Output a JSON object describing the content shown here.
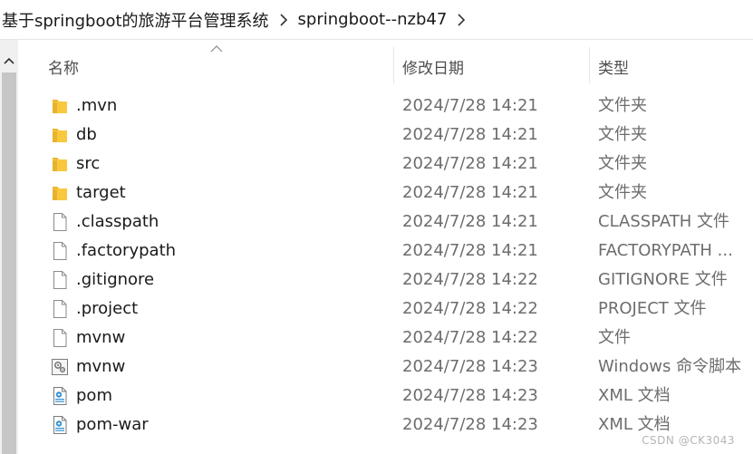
{
  "breadcrumb": {
    "items": [
      "基于springboot的旅游平台管理系统",
      "springboot--nzb47"
    ]
  },
  "columns": {
    "name": "名称",
    "date": "修改日期",
    "type": "类型"
  },
  "files": [
    {
      "name": ".mvn",
      "date": "2024/7/28 14:21",
      "type": "文件夹",
      "icon": "folder-icon"
    },
    {
      "name": "db",
      "date": "2024/7/28 14:21",
      "type": "文件夹",
      "icon": "folder-icon"
    },
    {
      "name": "src",
      "date": "2024/7/28 14:21",
      "type": "文件夹",
      "icon": "folder-icon"
    },
    {
      "name": "target",
      "date": "2024/7/28 14:21",
      "type": "文件夹",
      "icon": "folder-icon"
    },
    {
      "name": ".classpath",
      "date": "2024/7/28 14:21",
      "type": "CLASSPATH 文件",
      "icon": "file-icon"
    },
    {
      "name": ".factorypath",
      "date": "2024/7/28 14:21",
      "type": "FACTORYPATH ...",
      "icon": "file-icon"
    },
    {
      "name": ".gitignore",
      "date": "2024/7/28 14:22",
      "type": "GITIGNORE 文件",
      "icon": "file-icon"
    },
    {
      "name": ".project",
      "date": "2024/7/28 14:22",
      "type": "PROJECT 文件",
      "icon": "file-icon"
    },
    {
      "name": "mvnw",
      "date": "2024/7/28 14:22",
      "type": "文件",
      "icon": "file-icon"
    },
    {
      "name": "mvnw",
      "date": "2024/7/28 14:23",
      "type": "Windows 命令脚本",
      "icon": "script-icon"
    },
    {
      "name": "pom",
      "date": "2024/7/28 14:23",
      "type": "XML 文档",
      "icon": "xml-icon"
    },
    {
      "name": "pom-war",
      "date": "2024/7/28 14:23",
      "type": "XML 文档",
      "icon": "xml-icon"
    }
  ],
  "watermark": "CSDN @CK3043",
  "colors": {
    "folder": "#f8c93e",
    "thumb": "#c6c6c6",
    "muted_text": "#6d6d6d"
  }
}
